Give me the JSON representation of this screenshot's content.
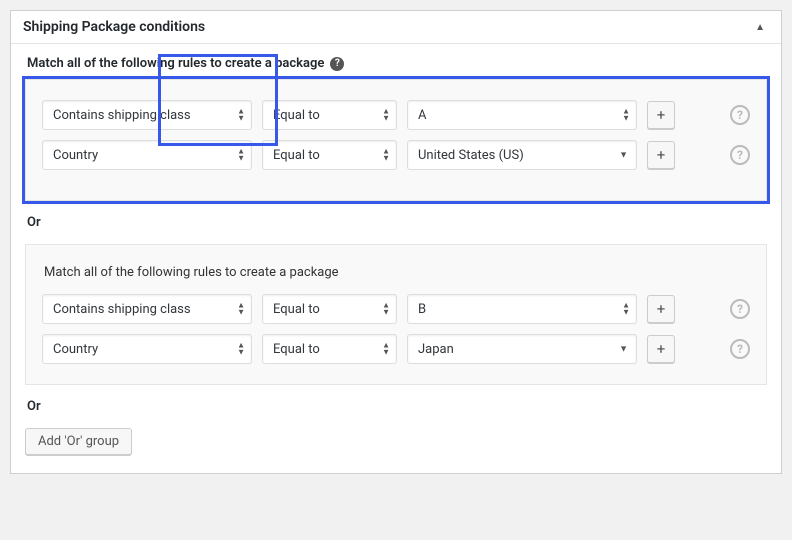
{
  "header": {
    "title": "Shipping Package conditions"
  },
  "labels": {
    "match_rules": "Match all of the following rules to create a package",
    "or": "Or",
    "add_or": "Add 'Or' group",
    "plus": "+",
    "help": "?"
  },
  "groups": [
    {
      "highlighted": true,
      "rules": [
        {
          "field": "Contains shipping class",
          "op": "Equal to",
          "value": "A",
          "value_style": "double"
        },
        {
          "field": "Country",
          "op": "Equal to",
          "value": "United States (US)",
          "value_style": "single"
        }
      ]
    },
    {
      "highlighted": false,
      "rules": [
        {
          "field": "Contains shipping class",
          "op": "Equal to",
          "value": "B",
          "value_style": "double"
        },
        {
          "field": "Country",
          "op": "Equal to",
          "value": "Japan",
          "value_style": "single"
        }
      ]
    }
  ]
}
